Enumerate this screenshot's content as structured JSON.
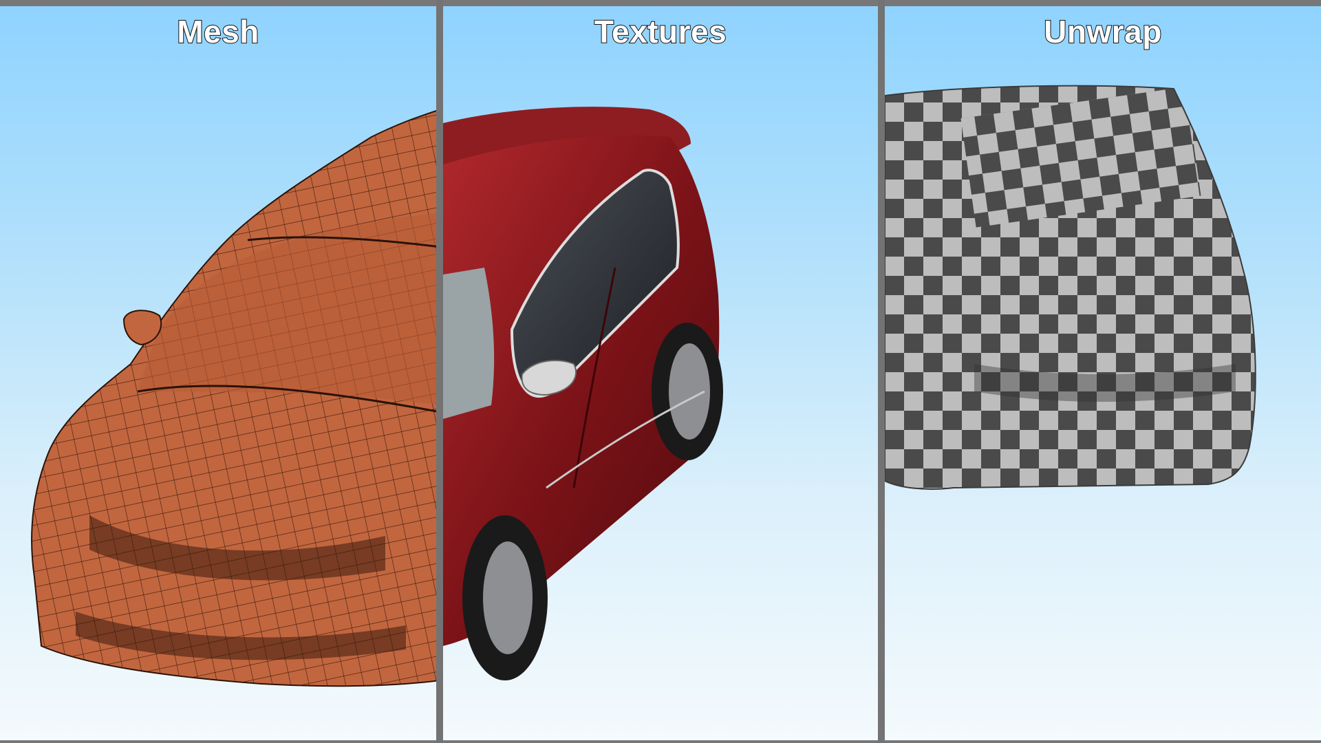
{
  "panels": [
    {
      "id": "mesh",
      "title": "Mesh"
    },
    {
      "id": "textures",
      "title": "Textures"
    },
    {
      "id": "unwrap",
      "title": "Unwrap"
    }
  ],
  "colors": {
    "sky_top": "#8fd3ff",
    "sky_bottom": "#f4fafd",
    "mesh_body": "#c2663f",
    "body_red": "#8a1a1e",
    "checker_dark": "#4a4a4a",
    "checker_light": "#bdbdbd",
    "divider": "#737373"
  },
  "icons": [
    "car-mesh-illustration",
    "car-textured-illustration",
    "car-uv-checker-illustration"
  ]
}
